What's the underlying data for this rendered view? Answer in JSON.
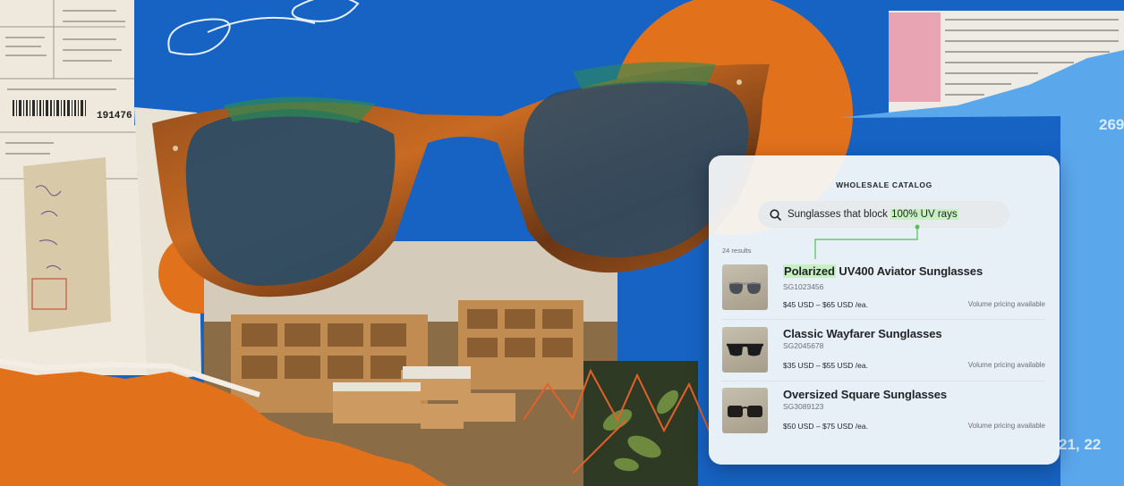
{
  "catalog": {
    "title": "WHOLESALE CATALOG",
    "search": {
      "query_prefix": "Sunglasses that block ",
      "query_highlight": "100% UV rays"
    },
    "result_count": "24 results",
    "products": [
      {
        "name_highlight": "Polarized",
        "name_rest": " UV400 Aviator Sunglasses",
        "sku": "SG1023456",
        "price": "$45 USD – $65 USD /ea.",
        "volume": "Volume pricing available",
        "thumb_icon": "aviator-sunglasses-icon"
      },
      {
        "name_highlight": "",
        "name_rest": "Classic Wayfarer Sunglasses",
        "sku": "SG2045678",
        "price": "$35 USD – $55 USD /ea.",
        "volume": "Volume pricing available",
        "thumb_icon": "wayfarer-sunglasses-icon"
      },
      {
        "name_highlight": "",
        "name_rest": "Oversized Square Sunglasses",
        "sku": "SG3089123",
        "price": "$50 USD – $75 USD /ea.",
        "volume": "Volume pricing available",
        "thumb_icon": "square-sunglasses-icon"
      }
    ]
  },
  "collage_text": {
    "receipt_number": "191476",
    "top_right_digits": "269",
    "bottom_right_digits": "21, 22"
  },
  "colors": {
    "background_blue": "#1763c4",
    "accent_orange": "#e2711c",
    "highlight_green": "#c6f0c0",
    "connector_green": "#4cc34a"
  }
}
